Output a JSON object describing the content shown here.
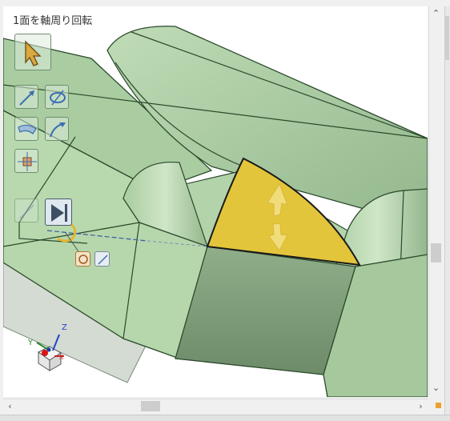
{
  "viewport": {
    "title": "1面を軸周り回転"
  },
  "colors": {
    "face_light": "#b6d6ad",
    "face_mid": "#a3c79b",
    "face_dark": "#7e9f7a",
    "highlight_face": "#e3c53c",
    "edge": "#1f3b1f",
    "grey_plane": "#d4dbd2"
  },
  "tools": [
    {
      "name": "select-arrow-icon"
    },
    {
      "name": "linear-move-icon"
    },
    {
      "name": "rotate-move-icon"
    },
    {
      "name": "offset-face-icon"
    },
    {
      "name": "curve-arrow-icon"
    },
    {
      "name": "scale-box-icon"
    },
    {
      "name": "pull-disabled-icon"
    },
    {
      "name": "play-step-icon"
    }
  ],
  "scroll": {
    "up": "⌃",
    "down": "⌄",
    "left": "‹",
    "right": "›"
  },
  "triad": {
    "x": "X",
    "y": "Y",
    "z": "Z"
  }
}
